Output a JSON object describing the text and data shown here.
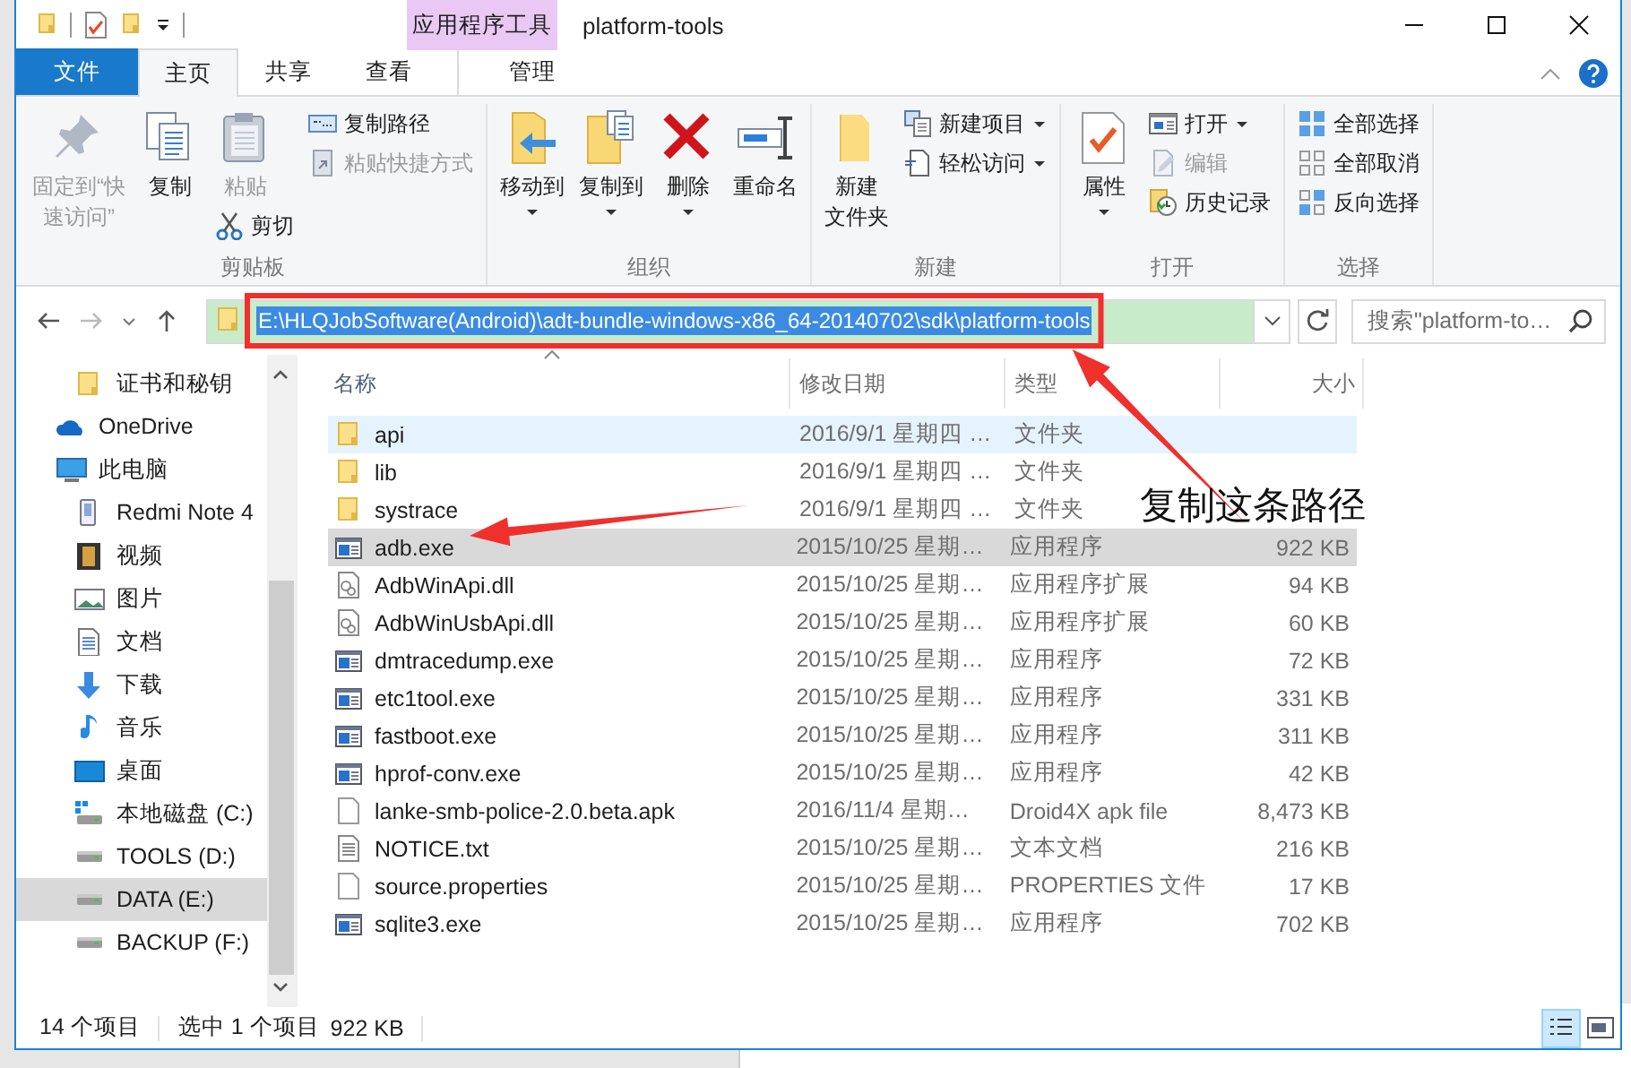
{
  "window": {
    "title": "platform-tools",
    "context_group": "应用程序工具"
  },
  "tabs": [
    {
      "label": "文件",
      "kind": "file",
      "selected": false
    },
    {
      "label": "主页",
      "kind": "normal",
      "selected": true
    },
    {
      "label": "共享",
      "kind": "normal",
      "selected": false
    },
    {
      "label": "查看",
      "kind": "normal",
      "selected": false
    },
    {
      "label": "管理",
      "kind": "context",
      "selected": false
    }
  ],
  "ribbon": {
    "groups": [
      {
        "label": "剪贴板",
        "columns": [
          {
            "large": {
              "kind": "pin",
              "lines": [
                "固定到“快",
                "速访问”"
              ],
              "disabled": true,
              "dropdown": false
            }
          },
          {
            "large": {
              "kind": "copy",
              "lines": [
                "复制"
              ],
              "disabled": false,
              "dropdown": false
            }
          },
          {
            "large": {
              "kind": "paste",
              "lines": [
                "粘贴"
              ],
              "disabled": true,
              "dropdown": false
            },
            "stack": [
              {
                "kind": "cut",
                "label": "剪切",
                "disabled": false,
                "dropdown": false
              }
            ]
          },
          {
            "stack": [
              {
                "kind": "copy-path",
                "label": "复制路径",
                "disabled": false,
                "dropdown": false
              },
              {
                "kind": "paste-shortcut",
                "label": "粘贴快捷方式",
                "disabled": true,
                "dropdown": false
              }
            ]
          }
        ]
      },
      {
        "label": "组织",
        "columns": [
          {
            "large": {
              "kind": "move",
              "lines": [
                "移动到"
              ],
              "disabled": false,
              "dropdown": true
            }
          },
          {
            "large": {
              "kind": "copy-to",
              "lines": [
                "复制到"
              ],
              "disabled": false,
              "dropdown": true
            }
          },
          {
            "large": {
              "kind": "delete",
              "lines": [
                "删除"
              ],
              "disabled": false,
              "dropdown": true
            }
          },
          {
            "large": {
              "kind": "rename",
              "lines": [
                "重命名"
              ],
              "disabled": false,
              "dropdown": false
            }
          }
        ]
      },
      {
        "label": "新建",
        "columns": [
          {
            "large": {
              "kind": "new-folder",
              "lines": [
                "新建",
                "文件夹"
              ],
              "disabled": false,
              "dropdown": false
            }
          },
          {
            "stack": [
              {
                "kind": "new-item",
                "label": "新建项目",
                "disabled": false,
                "dropdown": true
              },
              {
                "kind": "easy-access",
                "label": "轻松访问",
                "disabled": false,
                "dropdown": true
              }
            ]
          }
        ]
      },
      {
        "label": "打开",
        "columns": [
          {
            "large": {
              "kind": "properties",
              "lines": [
                "属性"
              ],
              "disabled": false,
              "dropdown": true
            }
          },
          {
            "stack": [
              {
                "kind": "open",
                "label": "打开",
                "disabled": false,
                "dropdown": true
              },
              {
                "kind": "edit",
                "label": "编辑",
                "disabled": true,
                "dropdown": false
              },
              {
                "kind": "history",
                "label": "历史记录",
                "disabled": false,
                "dropdown": false
              }
            ]
          }
        ]
      },
      {
        "label": "选择",
        "columns": [
          {
            "stack": [
              {
                "kind": "select-all",
                "label": "全部选择",
                "disabled": false,
                "dropdown": false
              },
              {
                "kind": "select-none",
                "label": "全部取消",
                "disabled": false,
                "dropdown": false
              },
              {
                "kind": "invert",
                "label": "反向选择",
                "disabled": false,
                "dropdown": false
              }
            ]
          }
        ]
      }
    ]
  },
  "address": {
    "path": "E:\\HLQJobSoftware(Android)\\adt-bundle-windows-x86_64-20140702\\sdk\\platform-tools",
    "level": 1
  },
  "search": {
    "placeholder": "搜索\"platform-to…"
  },
  "sidebar": {
    "items": [
      {
        "label": "证书和秘钥",
        "kind": "folder",
        "selected": false
      },
      {
        "label": "OneDrive",
        "kind": "cloud",
        "selected": false
      },
      {
        "label": "此电脑",
        "kind": "pc",
        "selected": false,
        "children": [
          {
            "label": "Redmi Note 4",
            "kind": "phone",
            "selected": false
          },
          {
            "label": "视频",
            "kind": "video",
            "selected": false
          },
          {
            "label": "图片",
            "kind": "pictures",
            "selected": false
          },
          {
            "label": "文档",
            "kind": "documents",
            "selected": false
          },
          {
            "label": "下载",
            "kind": "download",
            "selected": false
          },
          {
            "label": "音乐",
            "kind": "music",
            "selected": false
          },
          {
            "label": "桌面",
            "kind": "desktop",
            "selected": false
          },
          {
            "label": "本地磁盘 (C:)",
            "kind": "system-drive",
            "selected": false
          },
          {
            "label": "TOOLS (D:)",
            "kind": "drive",
            "selected": false
          },
          {
            "label": "DATA (E:)",
            "kind": "drive",
            "selected": true
          },
          {
            "label": "BACKUP (F:)",
            "kind": "drive",
            "selected": false
          }
        ]
      }
    ]
  },
  "table": {
    "columns": [
      "名称",
      "修改日期",
      "类型",
      "大小"
    ],
    "rows": [
      {
        "name": "api",
        "kind": "folder",
        "modified": "2016/9/1 星期四 …",
        "type": "文件夹",
        "hover": true,
        "selected": false
      },
      {
        "name": "lib",
        "kind": "folder",
        "modified": "2016/9/1 星期四 …",
        "type": "文件夹",
        "hover": false,
        "selected": false
      },
      {
        "name": "systrace",
        "kind": "folder",
        "modified": "2016/9/1 星期四 …",
        "type": "文件夹",
        "hover": false,
        "selected": false
      },
      {
        "name": "adb.exe",
        "kind": "exe",
        "modified": "2015/10/25 星期…",
        "type": "应用程序",
        "size": "922 KB",
        "hover": false,
        "selected": true
      },
      {
        "name": "AdbWinApi.dll",
        "kind": "dll",
        "modified": "2015/10/25 星期…",
        "type": "应用程序扩展",
        "size": "94 KB",
        "hover": false,
        "selected": false
      },
      {
        "name": "AdbWinUsbApi.dll",
        "kind": "dll",
        "modified": "2015/10/25 星期…",
        "type": "应用程序扩展",
        "size": "60 KB",
        "hover": false,
        "selected": false
      },
      {
        "name": "dmtracedump.exe",
        "kind": "exe",
        "modified": "2015/10/25 星期…",
        "type": "应用程序",
        "size": "72 KB",
        "hover": false,
        "selected": false
      },
      {
        "name": "etc1tool.exe",
        "kind": "exe",
        "modified": "2015/10/25 星期…",
        "type": "应用程序",
        "size": "331 KB",
        "hover": false,
        "selected": false
      },
      {
        "name": "fastboot.exe",
        "kind": "exe",
        "modified": "2015/10/25 星期…",
        "type": "应用程序",
        "size": "311 KB",
        "hover": false,
        "selected": false
      },
      {
        "name": "hprof-conv.exe",
        "kind": "exe",
        "modified": "2015/10/25 星期…",
        "type": "应用程序",
        "size": "42 KB",
        "hover": false,
        "selected": false
      },
      {
        "name": "lanke-smb-police-2.0.beta.apk",
        "kind": "file",
        "modified": "2016/11/4 星期…",
        "type": "Droid4X apk file",
        "size": "8,473 KB",
        "hover": false,
        "selected": false
      },
      {
        "name": "NOTICE.txt",
        "kind": "text",
        "modified": "2015/10/25 星期…",
        "type": "文本文档",
        "size": "216 KB",
        "hover": false,
        "selected": false
      },
      {
        "name": "source.properties",
        "kind": "file",
        "modified": "2015/10/25 星期…",
        "type": "PROPERTIES 文件",
        "size": "17 KB",
        "hover": false,
        "selected": false
      },
      {
        "name": "sqlite3.exe",
        "kind": "exe",
        "modified": "2015/10/25 星期…",
        "type": "应用程序",
        "size": "702 KB",
        "hover": false,
        "selected": false
      }
    ]
  },
  "status_bar": {
    "count": "14 个项目",
    "selection": "选中 1 个项目",
    "size": "922 KB"
  },
  "views": [
    {
      "kind": "details",
      "selected": true
    },
    {
      "kind": "large-icons",
      "selected": false
    }
  ],
  "annotation": {
    "label": "复制这条路径"
  }
}
